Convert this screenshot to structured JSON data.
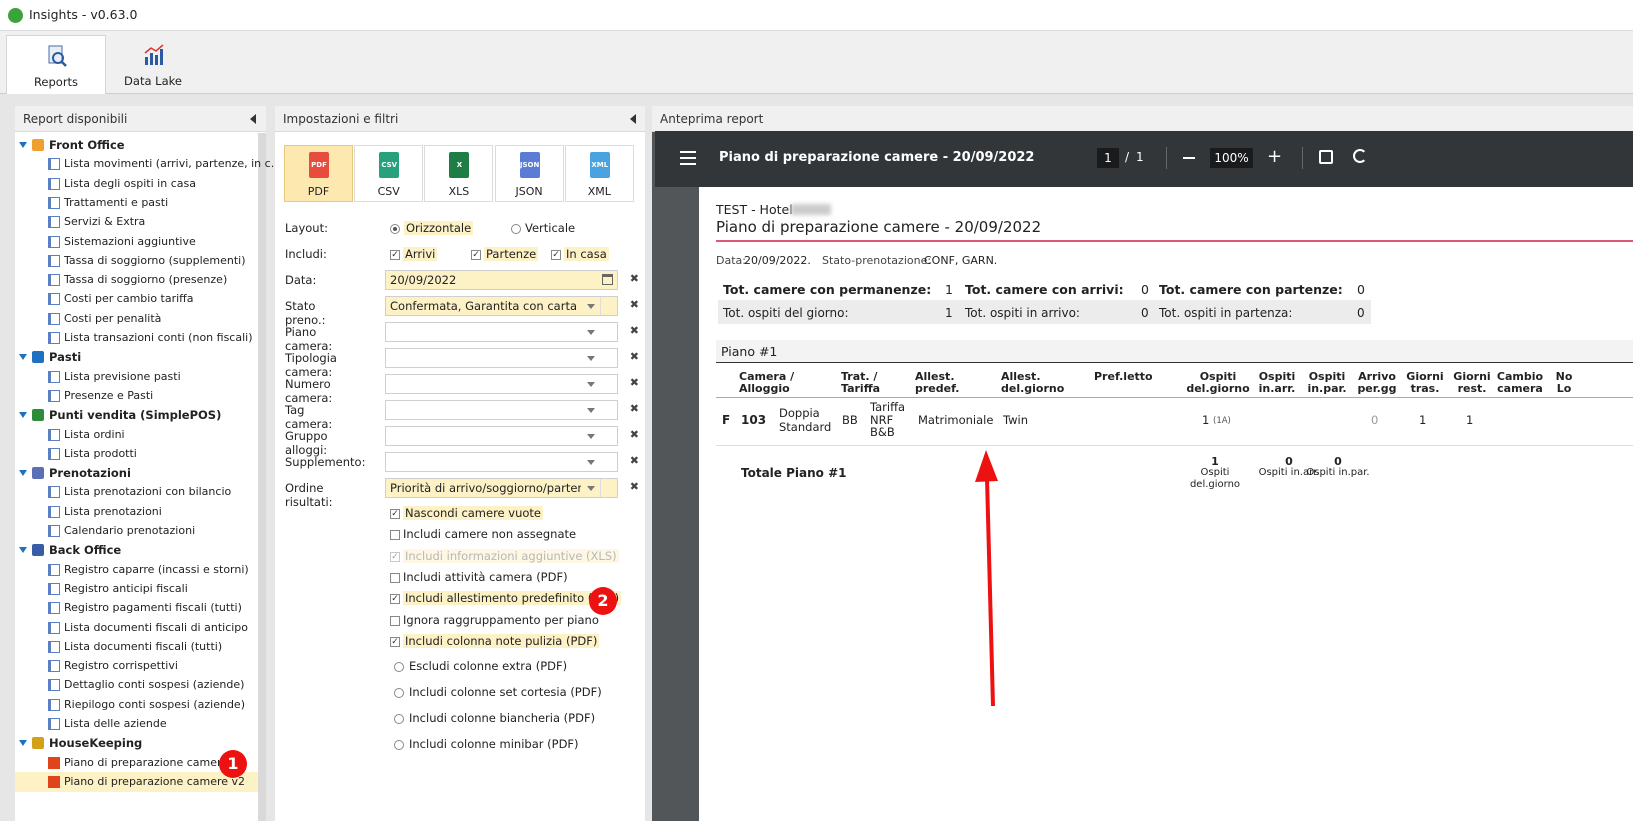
{
  "app": {
    "title": "Insights - v0.63.0"
  },
  "ribbon": {
    "tabs": [
      {
        "label": "Reports",
        "icon": "report-search-icon"
      },
      {
        "label": "Data Lake",
        "icon": "chart-icon"
      }
    ]
  },
  "left_panel": {
    "title": "Report disponibili",
    "groups": [
      {
        "label": "Front Office",
        "items": [
          "Lista movimenti (arrivi, partenze, in c...",
          "Lista degli ospiti in casa",
          "Trattamenti e pasti",
          "Servizi & Extra",
          "Sistemazioni aggiuntive",
          "Tassa di soggiorno (supplementi)",
          "Tassa di soggiorno (presenze)",
          "Costi per cambio tariffa",
          "Costi per penalità",
          "Lista transazioni conti (non fiscali)"
        ]
      },
      {
        "label": "Pasti",
        "items": [
          "Lista previsione pasti",
          "Presenze e Pasti"
        ]
      },
      {
        "label": "Punti vendita (SimplePOS)",
        "items": [
          "Lista ordini",
          "Lista prodotti"
        ]
      },
      {
        "label": "Prenotazioni",
        "items": [
          "Lista prenotazioni con bilancio",
          "Lista prenotazioni",
          "Calendario prenotazioni"
        ]
      },
      {
        "label": "Back Office",
        "items": [
          "Registro caparre (incassi e storni)",
          "Registro anticipi fiscali",
          "Registro pagamenti fiscali (tutti)",
          "Lista documenti fiscali di anticipo",
          "Lista documenti fiscali (tutti)",
          "Registro corrispettivi",
          "Dettaglio conti sospesi (aziende)",
          "Riepilogo conti sospesi (aziende)",
          "Lista delle aziende"
        ]
      },
      {
        "label": "HouseKeeping",
        "items": [
          "Piano di preparazione camere",
          "Piano di preparazione camere v2"
        ]
      }
    ],
    "badge": "1"
  },
  "mid_panel": {
    "title": "Impostazioni e filtri",
    "formats": [
      "PDF",
      "CSV",
      "XLS",
      "JSON",
      "XML"
    ],
    "layout_label": "Layout:",
    "layout_options": [
      "Orizzontale",
      "Verticale"
    ],
    "includi_label": "Includi:",
    "includi_options": [
      "Arrivi",
      "Partenze",
      "In casa"
    ],
    "fields": [
      {
        "label": "Data:",
        "value": "20/09/2022"
      },
      {
        "label": "Stato preno.:",
        "value": "Confermata, Garantita con carta di credito"
      },
      {
        "label": "Piano camera:",
        "value": ""
      },
      {
        "label": "Tipologia camera:",
        "value": ""
      },
      {
        "label": "Numero camera:",
        "value": ""
      },
      {
        "label": "Tag camera:",
        "value": ""
      },
      {
        "label": "Gruppo alloggi:",
        "value": ""
      },
      {
        "label": "Supplemento:",
        "value": ""
      },
      {
        "label": "Ordine risultati:",
        "value": "Priorità di arrivo/soggiorno/partenza"
      }
    ],
    "checks": [
      "Nascondi camere vuote",
      "Includi camere non assegnate",
      "Includi informazioni aggiuntive (XLS)",
      "Includi attività camera (PDF)",
      "Includi allestimento predefinito (PDF)",
      "Ignora raggruppamento per piano",
      "Includi colonna note pulizia (PDF)"
    ],
    "radios": [
      "Escludi colonne extra (PDF)",
      "Includi colonne set cortesia (PDF)",
      "Includi colonne biancheria (PDF)",
      "Includi colonne minibar (PDF)"
    ],
    "badge": "2"
  },
  "right_panel": {
    "title": "Anteprima report",
    "viewer": {
      "doc_title": "Piano di preparazione camere - 20/09/2022",
      "page": "1",
      "sep": "/",
      "pages": "1",
      "zoom": "100%"
    },
    "report": {
      "hotel": "TEST - Hotel",
      "heading": "Piano di preparazione camere - 20/09/2022",
      "data_label": "Data:",
      "data_value": "20/09/2022.",
      "stato_label": "Stato-prenotazione:",
      "stato_value": "CONF, GARN.",
      "summary": [
        [
          "Tot. camere con permanenze:",
          "1",
          "Tot. camere con arrivi:",
          "0",
          "Tot. camere con partenze:",
          "0"
        ],
        [
          "Tot. ospiti del giorno:",
          "1",
          "Tot. ospiti in arrivo:",
          "0",
          "Tot. ospiti in partenza:",
          "0"
        ]
      ],
      "floor": "Piano #1",
      "columns": [
        "Camera / Alloggio",
        "Trat. / Tariffa",
        "Allest. predef.",
        "Allest. del.giorno",
        "Pref.letto",
        "Ospiti del.giorno",
        "Ospiti in.arr.",
        "Ospiti in.par.",
        "Arrivo per.gg",
        "Giorni tras.",
        "Giorni rest.",
        "Cambio camera",
        "No Lo"
      ],
      "row": {
        "flag": "F",
        "camera": "103",
        "tipo": "Doppia Standard",
        "trat": "BB",
        "tariffa": "Tariffa NRF B&B",
        "allest_predef": "Matrimoniale",
        "allest_giorno": "Twin",
        "ospiti": "1",
        "ospiti_note": "(1A)",
        "arrivo": "0",
        "giorni_tras": "1",
        "giorni_rest": "1"
      },
      "total": {
        "label": "Totale Piano #1",
        "ospiti": "1",
        "ospiti_lbl": "Ospiti del.giorno",
        "arr": "0",
        "arr_lbl": "Ospiti in.arr.",
        "par": "0",
        "par_lbl": "Ospiti in.par."
      }
    }
  },
  "colors": {
    "accent_red": "#e11111",
    "highlight": "#fdf1c6",
    "pdf_toolbar": "#323639"
  }
}
